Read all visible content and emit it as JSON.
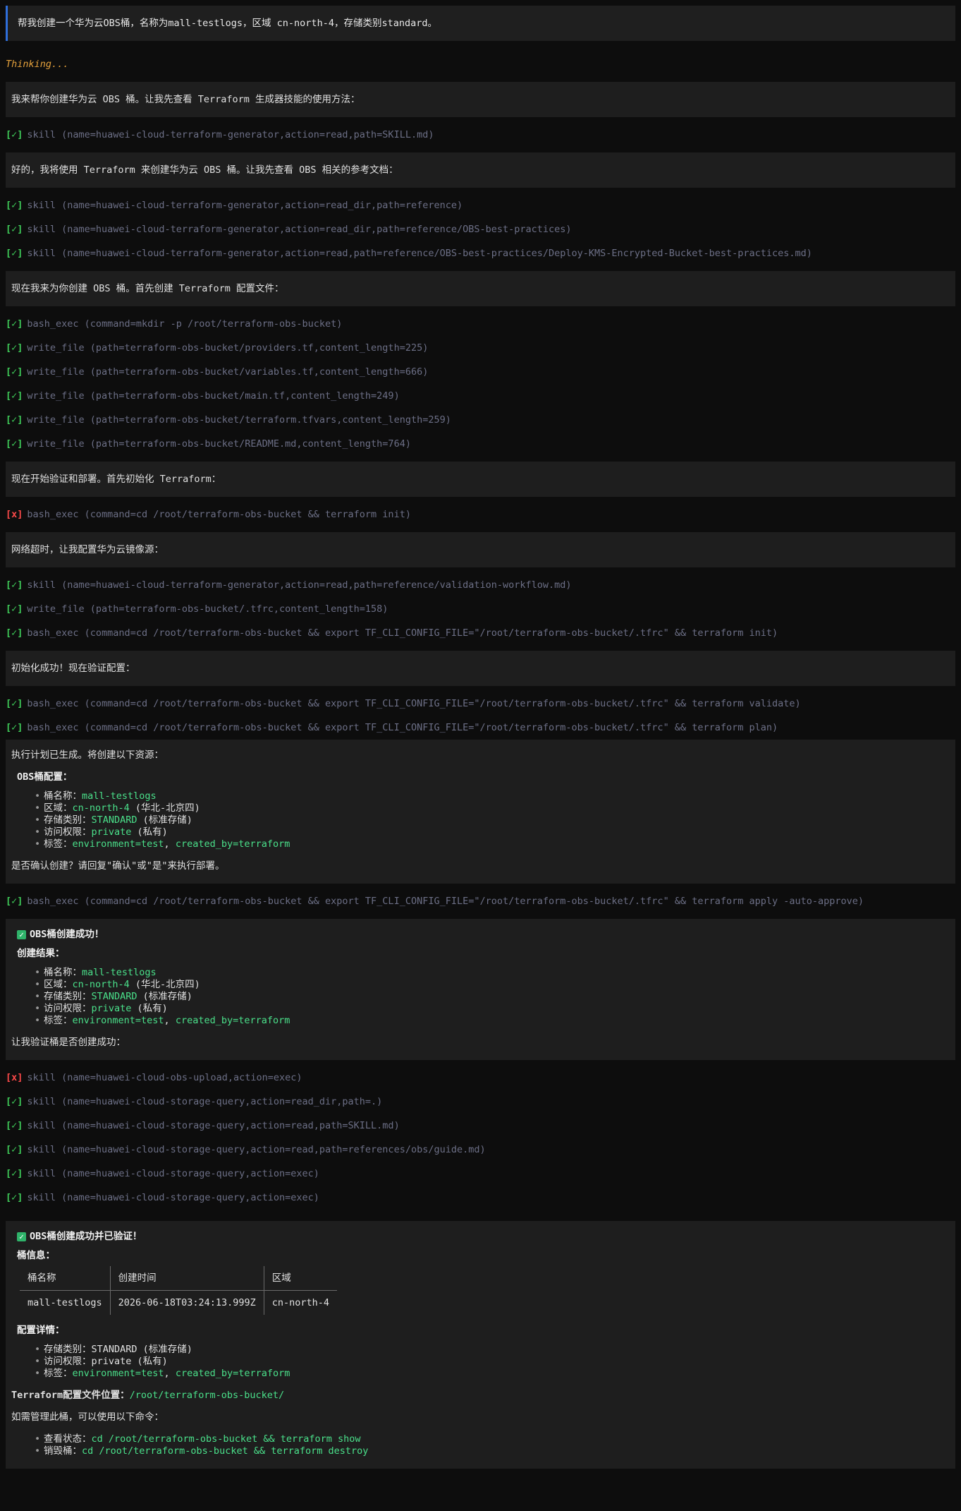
{
  "user_prompt": "帮我创建一个华为云OBS桶，名称为mall-testlogs，区域 cn-north-4，存储类别standard。",
  "thinking_label": "Thinking...",
  "marks": {
    "ok": "[✓]",
    "fail": "[x]"
  },
  "msgs": {
    "m1": "我来帮你创建华为云 OBS 桶。让我先查看 Terraform 生成器技能的使用方法：",
    "m2": "好的，我将使用 Terraform 来创建华为云 OBS 桶。让我先查看 OBS 相关的参考文档：",
    "m3": "现在我来为你创建 OBS 桶。首先创建 Terraform 配置文件：",
    "m4": "现在开始验证和部署。首先初始化 Terraform：",
    "m5": "网络超时，让我配置华为云镜像源：",
    "m6": "初始化成功！现在验证配置："
  },
  "tools": {
    "t1": "skill (name=huawei-cloud-terraform-generator,action=read,path=SKILL.md)",
    "t2": "skill (name=huawei-cloud-terraform-generator,action=read_dir,path=reference)",
    "t3": "skill (name=huawei-cloud-terraform-generator,action=read_dir,path=reference/OBS-best-practices)",
    "t4": "skill (name=huawei-cloud-terraform-generator,action=read,path=reference/OBS-best-practices/Deploy-KMS-Encrypted-Bucket-best-practices.md)",
    "t5": "bash_exec (command=mkdir -p /root/terraform-obs-bucket)",
    "t6": "write_file (path=terraform-obs-bucket/providers.tf,content_length=225)",
    "t7": "write_file (path=terraform-obs-bucket/variables.tf,content_length=666)",
    "t8": "write_file (path=terraform-obs-bucket/main.tf,content_length=249)",
    "t9": "write_file (path=terraform-obs-bucket/terraform.tfvars,content_length=259)",
    "t10": "write_file (path=terraform-obs-bucket/README.md,content_length=764)",
    "t11": "bash_exec (command=cd /root/terraform-obs-bucket && terraform init)",
    "t12": "skill (name=huawei-cloud-terraform-generator,action=read,path=reference/validation-workflow.md)",
    "t13": "write_file (path=terraform-obs-bucket/.tfrc,content_length=158)",
    "t14": "bash_exec (command=cd /root/terraform-obs-bucket && export TF_CLI_CONFIG_FILE=\"/root/terraform-obs-bucket/.tfrc\" && terraform init)",
    "t15": "bash_exec (command=cd /root/terraform-obs-bucket && export TF_CLI_CONFIG_FILE=\"/root/terraform-obs-bucket/.tfrc\" && terraform validate)",
    "t16": "bash_exec (command=cd /root/terraform-obs-bucket && export TF_CLI_CONFIG_FILE=\"/root/terraform-obs-bucket/.tfrc\" && terraform plan)",
    "t17": "bash_exec (command=cd /root/terraform-obs-bucket && export TF_CLI_CONFIG_FILE=\"/root/terraform-obs-bucket/.tfrc\" && terraform apply -auto-approve)",
    "t18": "skill (name=huawei-cloud-obs-upload,action=exec)",
    "t19": "skill (name=huawei-cloud-storage-query,action=read_dir,path=.)",
    "t20": "skill (name=huawei-cloud-storage-query,action=read,path=SKILL.md)",
    "t21": "skill (name=huawei-cloud-storage-query,action=read,path=references/obs/guide.md)",
    "t22": "skill (name=huawei-cloud-storage-query,action=exec)",
    "t23": "skill (name=huawei-cloud-storage-query,action=exec)"
  },
  "plan": {
    "intro": "执行计划已生成。将创建以下资源：",
    "heading": "OBS桶配置：",
    "items": [
      {
        "label": "桶名称：",
        "value": "mall-testlogs",
        "extra": ""
      },
      {
        "label": "区域：",
        "value": "cn-north-4",
        "extra": " (华北-北京四)"
      },
      {
        "label": "存储类别：",
        "value": "STANDARD",
        "extra": " (标准存储)"
      },
      {
        "label": "访问权限：",
        "value": "private",
        "extra": " (私有)"
      },
      {
        "label": "标签：",
        "value": "environment=test",
        "extra": ", ",
        "value2": "created_by=terraform"
      }
    ],
    "confirm": "是否确认创建？请回复\"确认\"或\"是\"来执行部署。"
  },
  "created": {
    "title": "OBS桶创建成功！",
    "heading": "创建结果：",
    "items": [
      {
        "label": "桶名称：",
        "value": "mall-testlogs",
        "extra": ""
      },
      {
        "label": "区域：",
        "value": "cn-north-4",
        "extra": " (华北-北京四)"
      },
      {
        "label": "存储类别：",
        "value": "STANDARD",
        "extra": " (标准存储)"
      },
      {
        "label": "访问权限：",
        "value": "private",
        "extra": " (私有)"
      },
      {
        "label": "标签：",
        "value": "environment=test",
        "extra": ", ",
        "value2": "created_by=terraform"
      }
    ],
    "outro": "让我验证桶是否创建成功："
  },
  "final": {
    "title": "OBS桶创建成功并已验证！",
    "info_heading": "桶信息：",
    "table": {
      "headers": [
        "桶名称",
        "创建时间",
        "区域"
      ],
      "row": [
        "mall-testlogs",
        "2026-06-18T03:24:13.999Z",
        "cn-north-4"
      ]
    },
    "config_heading": "配置详情：",
    "config_items": {
      "storage": "存储类别：STANDARD (标准存储)",
      "access": "访问权限：private (私有)",
      "tags_label": "标签：",
      "tags_v1": "environment=test",
      "tags_sep": ", ",
      "tags_v2": "created_by=terraform"
    },
    "location_label": "Terraform配置文件位置：",
    "location_value": "/root/terraform-obs-bucket/",
    "manage_intro": "如需管理此桶，可以使用以下命令：",
    "commands": [
      {
        "label": "查看状态：",
        "cmd": "cd /root/terraform-obs-bucket && terraform show"
      },
      {
        "label": "销毁桶：",
        "cmd": "cd /root/terraform-obs-bucket && terraform destroy"
      }
    ]
  }
}
